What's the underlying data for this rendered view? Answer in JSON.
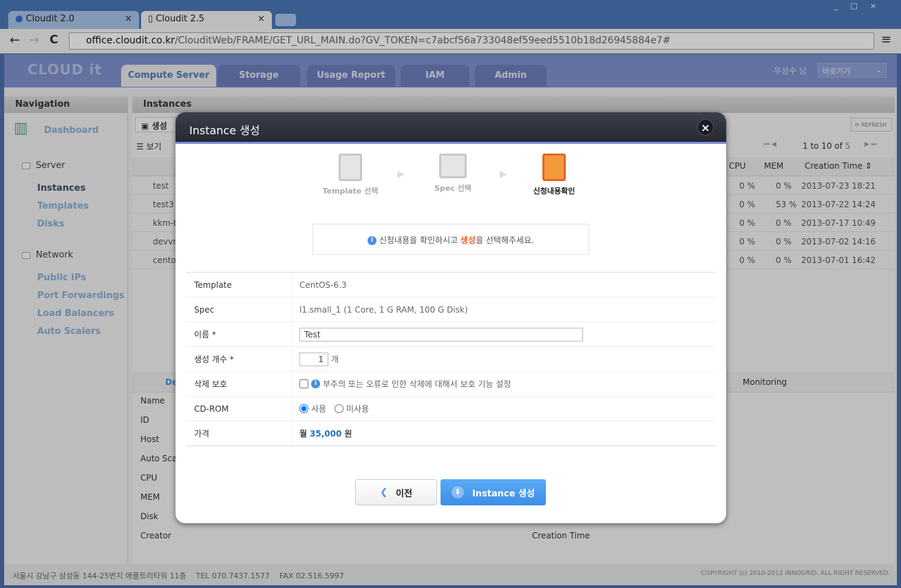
{
  "browser": {
    "tabs": [
      {
        "title": "Cloudit 2.0"
      },
      {
        "title": "Cloudit 2.5"
      }
    ],
    "url_host": "office.cloudit.co.kr",
    "url_path": "/ClouditWeb/FRAME/GET_URL_MAIN.do?GV_TOKEN=c7abcf56a733048ef59eed5510b18d26945884e7#"
  },
  "header": {
    "logo": "CLOUD it",
    "tabs": [
      "Compute Server",
      "Storage",
      "Usage Report",
      "IAM",
      "Admin"
    ],
    "user": "우상수 님",
    "shortcut_select": "바로가기"
  },
  "nav": {
    "title": "Navigation",
    "dashboard": "Dashboard",
    "groups": [
      {
        "label": "Server",
        "items": [
          "Instances",
          "Templates",
          "Disks"
        ]
      },
      {
        "label": "Network",
        "items": [
          "Public IPs",
          "Port Forwardings",
          "Load Balancers",
          "Auto Scalers"
        ]
      }
    ]
  },
  "instances": {
    "title": "Instances",
    "create_btn": "생성",
    "view_btn": "보기",
    "refresh": "REFRESH",
    "paging": {
      "text": "1 to 10 of",
      "total": "5"
    },
    "columns": [
      "CPU",
      "MEM",
      "Creation Time"
    ],
    "rows": [
      {
        "name": "test",
        "cpu": "0 %",
        "mem": "0 %",
        "time": "2013-07-23 18:21"
      },
      {
        "name": "test3",
        "cpu": "0 %",
        "mem": "53 %",
        "time": "2013-07-22 14:24"
      },
      {
        "name": "kkm-t",
        "cpu": "0 %",
        "mem": "0 %",
        "time": "2013-07-17 10:49"
      },
      {
        "name": "devvm",
        "cpu": "0 %",
        "mem": "0 %",
        "time": "2013-07-02 14:16"
      },
      {
        "name": "cento",
        "cpu": "0 %",
        "mem": "0 %",
        "time": "2013-07-01 16:42"
      }
    ],
    "detail_tabs": [
      "De",
      "Monitoring"
    ],
    "detail_labels": [
      "Name",
      "ID",
      "Host",
      "Auto Sca",
      "CPU",
      "MEM",
      "Disk",
      "Creator"
    ],
    "detail_right": "Creation Time"
  },
  "footer": {
    "address": "서울시 강남구 삼성동 144-25번지 애플트리타워 11층",
    "tel": "TEL 070.7437.1577",
    "fax": "FAX 02.516.5997",
    "copyright": "COPYRIGHT (c) 2010-2012 INNOGRID. ALL RIGHT RESERVED."
  },
  "modal": {
    "title": "Instance 생성",
    "steps": [
      "Template 선택",
      "Spec 선택",
      "신청내용확인"
    ],
    "active_step": 3,
    "notice_pre": "신청내용을 확인하시고 ",
    "notice_hl": "생성",
    "notice_post": "을 선택해주세요.",
    "fields": {
      "template_label": "Template",
      "template": "CentOS-6.3",
      "spec_label": "Spec",
      "spec": "l1.small_1 (1 Core, 1 G RAM, 100 G Disk)",
      "name_label": "이름 *",
      "name": "Test",
      "count_label": "생성 개수 *",
      "count": "1",
      "count_unit": "개",
      "protect_label": "삭제 보호",
      "protect_text": "부주의 또는 오류로 인한 삭제에 대해서 보호 기능 설정",
      "protect_checked": false,
      "cdrom_label": "CD-ROM",
      "cdrom_options": [
        "사용",
        "미사용"
      ],
      "cdrom_selected": "사용",
      "price_label": "가격",
      "price_pre": "월",
      "price": "35,000",
      "price_unit": "원"
    },
    "prev_btn": "이전",
    "create_btn": "Instance 생성"
  },
  "colors": {
    "accent": "#4a90e2",
    "highlight": "#e8632b",
    "header": "#7f92cf"
  }
}
